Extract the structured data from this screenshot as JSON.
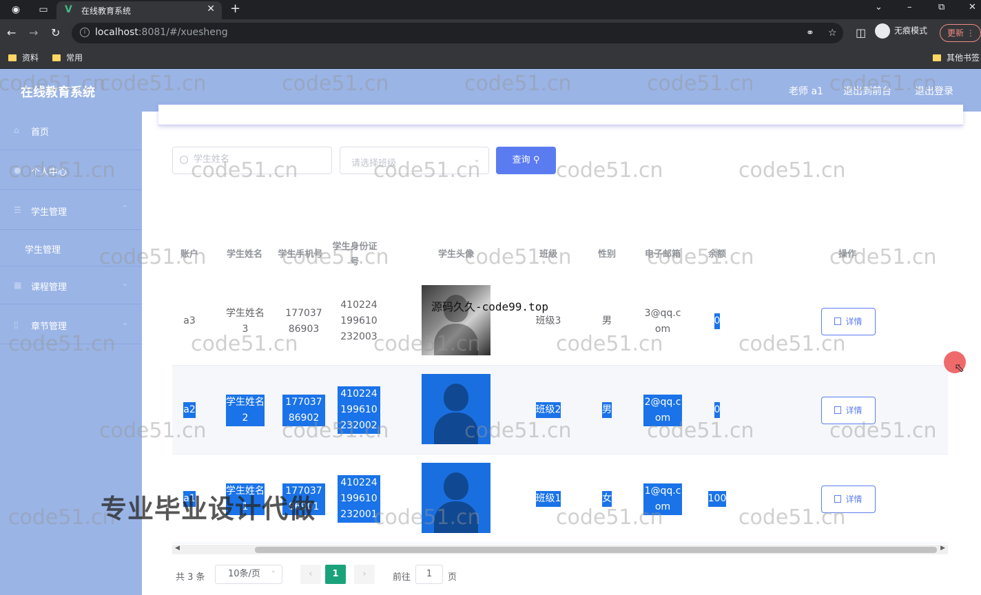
{
  "browser": {
    "tab_title": "在线教育系统",
    "tab_favicon": "V",
    "url_host": "localhost",
    "url_rest": ":8081/#/xuesheng",
    "incognito_label": "无痕模式",
    "update_label": "更新",
    "bookmarks": [
      "资料",
      "常用"
    ],
    "bookmarks_other": "其他书签"
  },
  "header": {
    "title": "在线教育系统",
    "user": "老师 a1",
    "front_link": "退出到前台",
    "logout_link": "退出登录",
    "color": "#9ab4e6"
  },
  "sidebar": {
    "items": [
      {
        "label": "首页",
        "icon": "home-icon"
      },
      {
        "label": "个人中心",
        "icon": "user-icon"
      },
      {
        "label": "学生管理",
        "icon": "menu-icon"
      },
      {
        "label": "学生管理",
        "icon": ""
      },
      {
        "label": "课程管理",
        "icon": "grid-icon"
      },
      {
        "label": "章节管理",
        "icon": "doc-icon"
      }
    ]
  },
  "search": {
    "name_placeholder": "学生姓名",
    "class_placeholder": "请选择班级",
    "query_label": "查询"
  },
  "table": {
    "headers": [
      "账户",
      "学生姓名",
      "学生手机号",
      "学生身份证号",
      "学生头像",
      "班级",
      "性别",
      "电子邮箱",
      "余额",
      "操作"
    ],
    "rows": [
      {
        "account": "a3",
        "name": "学生姓名3",
        "phone": "17703786903",
        "idcard": "410224199610232003",
        "class": "班级3",
        "gender": "男",
        "email": "3@qq.com",
        "balance": "0",
        "action": "详情"
      },
      {
        "account": "a2",
        "name": "学生姓名2",
        "phone": "17703786902",
        "idcard": "410224199610232002",
        "class": "班级2",
        "gender": "男",
        "email": "2@qq.com",
        "balance": "0",
        "action": "详情"
      },
      {
        "account": "a1",
        "name": "学生姓名1",
        "phone": "17703786901",
        "idcard": "410224199610232001",
        "class": "班级1",
        "gender": "女",
        "email": "1@qq.com",
        "balance": "100",
        "action": "详情"
      }
    ]
  },
  "pagination": {
    "total": "共 3 条",
    "page_size": "10条/页",
    "current_page": "1",
    "goto_label": "前往",
    "goto_value": "1",
    "page_suffix": "页"
  },
  "overlay": {
    "watermark": "code51.cn",
    "code_text": "源码久久-code99.top",
    "promo_text": "专业毕业设计代做"
  }
}
